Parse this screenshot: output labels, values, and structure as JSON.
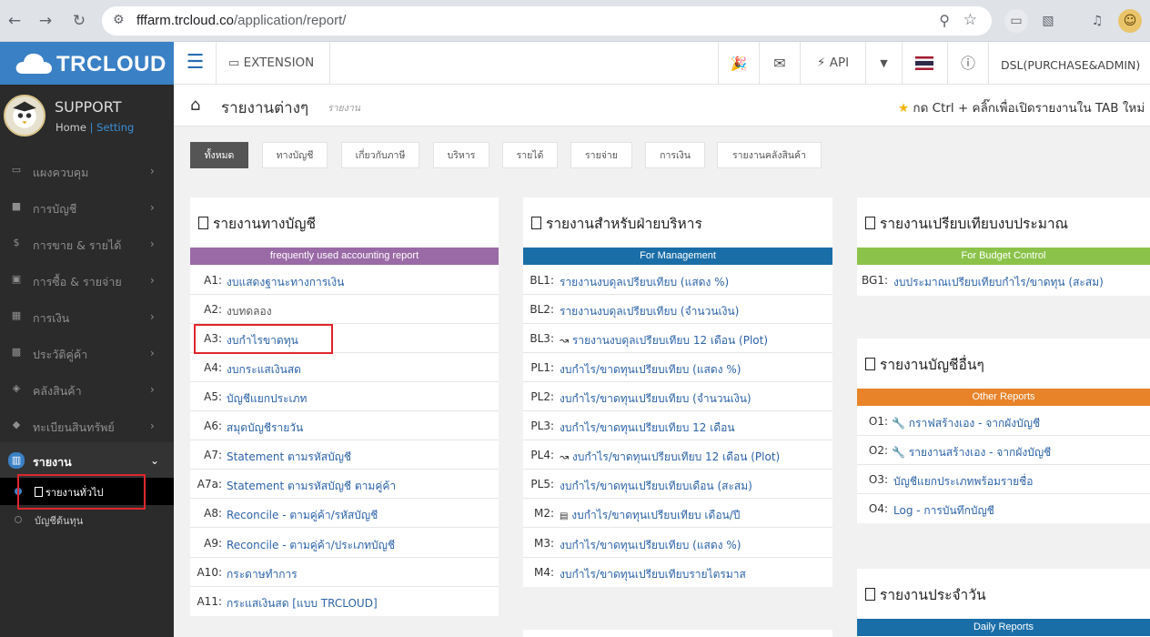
{
  "browser": {
    "url_host": "fffarm.trcloud.co",
    "url_path": "/application/report/",
    "back_icon": "arrow-left",
    "forward_icon": "arrow-right",
    "reload_icon": "reload"
  },
  "header": {
    "logo": "TRCLOUD",
    "extension_label": "EXTENSION",
    "api_label": "API",
    "user": "DSL(PURCHASE&ADMIN)"
  },
  "sidebar": {
    "profile_name": "SUPPORT",
    "home_link": "Home",
    "sep": "|",
    "setting_link": "Setting",
    "items": [
      {
        "label": "แผงควบคุม",
        "icon": "monitor-icon"
      },
      {
        "label": "การบัญชี",
        "icon": "book-icon"
      },
      {
        "label": "การขาย & รายได้",
        "icon": "dollar-icon"
      },
      {
        "label": "การซื้อ & รายจ่าย",
        "icon": "cart-icon"
      },
      {
        "label": "การเงิน",
        "icon": "calendar-icon"
      },
      {
        "label": "ประวัติคู่ค้า",
        "icon": "contact-icon"
      },
      {
        "label": "คลังสินค้า",
        "icon": "cubes-icon"
      },
      {
        "label": "ทะเบียนสินทรัพย์",
        "icon": "diamond-icon"
      },
      {
        "label": "รายงาน",
        "icon": "report-icon"
      }
    ],
    "sub_items": [
      {
        "label": "รายงานทั่วไป"
      },
      {
        "label": "บัญชีต้นทุน"
      }
    ]
  },
  "breadcrumb": {
    "title": "รายงานต่างๆ",
    "subtitle": "รายงาน",
    "tip": "กด Ctrl + คลิ๊กเพื่อเปิดรายงานใน TAB ใหม่"
  },
  "tabs": [
    "ทั้งหมด",
    "ทางบัญชี",
    "เกี่ยวกับภาษี",
    "บริหาร",
    "รายได้",
    "รายจ่าย",
    "การเงิน",
    "รายงานคลังสินค้า"
  ],
  "panels": {
    "accounting": {
      "title": "รายงานทางบัญชี",
      "band": "frequently used accounting report",
      "band_color": "#9a6aa6",
      "rows": [
        {
          "code": "A1:",
          "label": "งบแสดงฐานะทางการเงิน"
        },
        {
          "code": "A2:",
          "label": "งบทดลอง"
        },
        {
          "code": "A3:",
          "label": "งบกำไรขาดทุน"
        },
        {
          "code": "A4:",
          "label": "งบกระแสเงินสด"
        },
        {
          "code": "A5:",
          "label": "บัญชีแยกประเภท"
        },
        {
          "code": "A6:",
          "label": "สมุดบัญชีรายวัน"
        },
        {
          "code": "A7:",
          "label": "Statement ตามรหัสบัญชี"
        },
        {
          "code": "A7a:",
          "label": "Statement ตามรหัสบัญชี ตามคู่ค้า"
        },
        {
          "code": "A8:",
          "label": "Reconcile - ตามคู่ค้า/รหัสบัญชี"
        },
        {
          "code": "A9:",
          "label": "Reconcile - ตามคู่ค้า/ประเภทบัญชี"
        },
        {
          "code": "A10:",
          "label": "กระดาษทำการ"
        },
        {
          "code": "A11:",
          "label": "กระแสเงินสด [แบบ TRCLOUD]"
        }
      ]
    },
    "management": {
      "title": "รายงานสำหรับฝ่ายบริหาร",
      "band": "For Management",
      "band_color": "#1a6ea8",
      "rows": [
        {
          "code": "BL1:",
          "label": "รายงานงบดุลเปรียบเทียบ (แสดง %)"
        },
        {
          "code": "BL2:",
          "label": "รายงานงบดุลเปรียบเทียบ (จำนวนเงิน)"
        },
        {
          "code": "BL3:",
          "label": "รายงานงบดุลเปรียบเทียบ 12 เดือน (Plot)",
          "icon": "line-chart-icon"
        },
        {
          "code": "PL1:",
          "label": "งบกำไร/ขาดทุนเปรียบเทียบ (แสดง %)"
        },
        {
          "code": "PL2:",
          "label": "งบกำไร/ขาดทุนเปรียบเทียบ (จำนวนเงิน)"
        },
        {
          "code": "PL3:",
          "label": "งบกำไร/ขาดทุนเปรียบเทียบ 12 เดือน"
        },
        {
          "code": "PL4:",
          "label": "งบกำไร/ขาดทุนเปรียบเทียบ 12 เดือน (Plot)",
          "icon": "line-chart-icon"
        },
        {
          "code": "PL5:",
          "label": "งบกำไร/ขาดทุนเปรียบเทียบเดือน (สะสม)"
        },
        {
          "code": "M2:",
          "label": "งบกำไร/ขาดทุนเปรียบเทียบ เดือน/ปี",
          "icon": "print-icon"
        },
        {
          "code": "M3:",
          "label": "งบกำไร/ขาดทุนเปรียบเทียบ (แสดง %)"
        },
        {
          "code": "M4:",
          "label": "งบกำไร/ขาดทุนเปรียบเทียบรายไตรมาส"
        }
      ]
    },
    "budget": {
      "title": "รายงานเปรียบเทียบงบประมาณ",
      "band": "For Budget Control",
      "band_color": "#8bc34a",
      "rows": [
        {
          "code": "BG1:",
          "label": "งบประมาณเปรียบเทียบกำไร/ขาดทุน (สะสม)"
        }
      ]
    },
    "other": {
      "title": "รายงานบัญชีอื่นๆ",
      "band": "Other Reports",
      "band_color": "#e8832a",
      "rows": [
        {
          "code": "O1:",
          "label": "กราฟสร้างเอง - จากผังบัญชี",
          "icon": "wrench-icon"
        },
        {
          "code": "O2:",
          "label": "รายงานสร้างเอง - จากผังบัญชี",
          "icon": "wrench-icon"
        },
        {
          "code": "O3:",
          "label": "บัญชีแยกประเภทพร้อมรายชื่อ"
        },
        {
          "code": "O4:",
          "label": "Log - การบันทึกบัญชี"
        }
      ]
    },
    "daily": {
      "title": "รายงานประจำวัน",
      "band": "Daily Reports",
      "band_color": "#1a6ea8"
    }
  }
}
